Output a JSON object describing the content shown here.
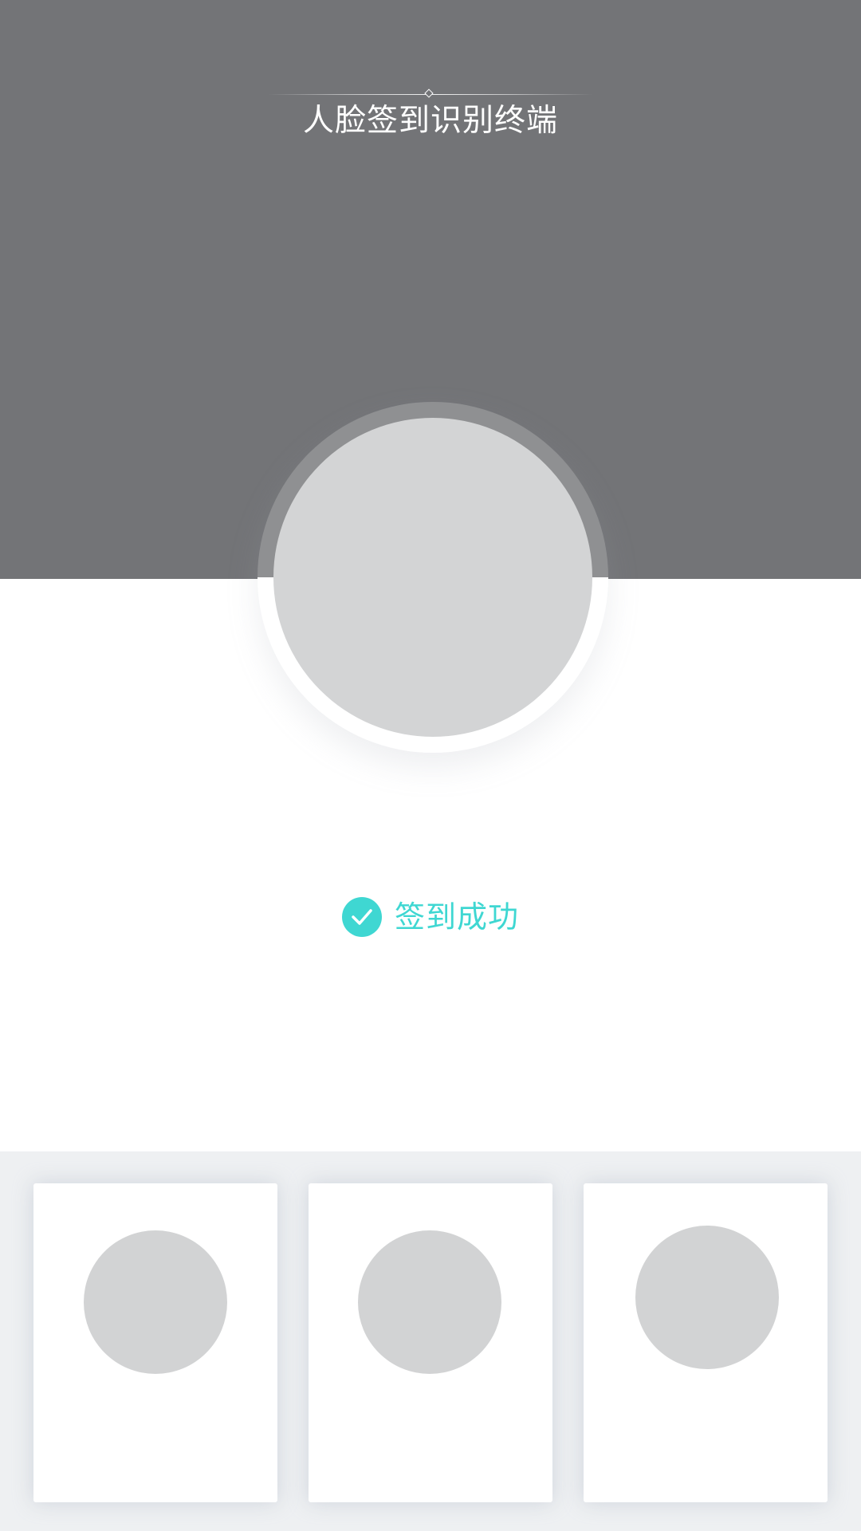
{
  "header": {
    "title": "人脸签到识别终端",
    "background_color": "#737477"
  },
  "face_capture": {
    "ring_color": "#8f9092",
    "placeholder_color": "#d3d4d5"
  },
  "status": {
    "icon": "check-circle-icon",
    "text": "签到成功",
    "color": "#3fd7d2"
  },
  "recent_checkins": {
    "background_color": "#eef0f2",
    "cards": [
      {
        "avatar": "avatar-placeholder"
      },
      {
        "avatar": "avatar-placeholder"
      },
      {
        "avatar": "avatar-placeholder"
      }
    ]
  }
}
